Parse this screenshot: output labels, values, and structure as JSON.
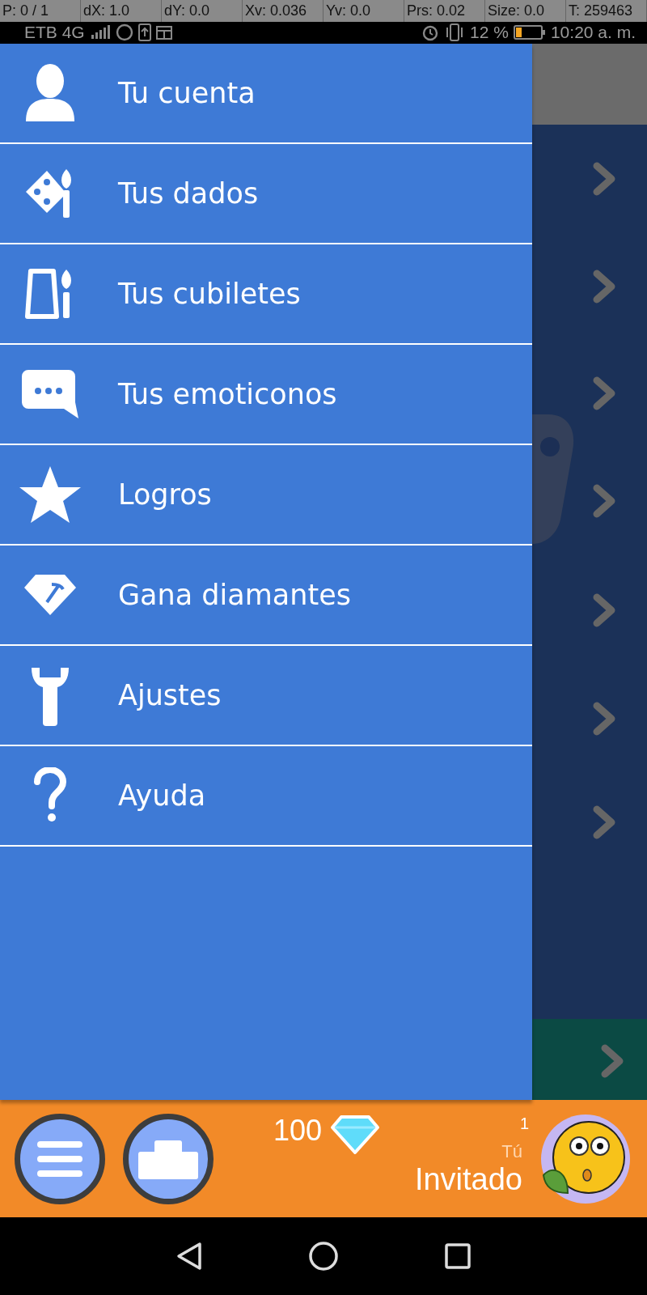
{
  "debug_overlay": [
    "P: 0 / 1",
    "dX: 1.0",
    "dY: 0.0",
    "Xv: 0.036",
    "Yv: 0.0",
    "Prs: 0.02",
    "Size: 0.0",
    "T: 259463"
  ],
  "status_bar": {
    "carrier": "ETB 4G",
    "battery": "12 %",
    "time": "10:20 a. m."
  },
  "menu": [
    {
      "label": "Tu cuenta"
    },
    {
      "label": "Tus dados"
    },
    {
      "label": "Tus cubiletes"
    },
    {
      "label": "Tus emoticonos"
    },
    {
      "label": "Logros"
    },
    {
      "label": "Gana diamantes"
    },
    {
      "label": "Ajustes"
    },
    {
      "label": "Ayuda"
    }
  ],
  "bottom_bar": {
    "diamonds": "100",
    "rank": "1",
    "you_label": "Tú",
    "player_name": "Invitado"
  }
}
